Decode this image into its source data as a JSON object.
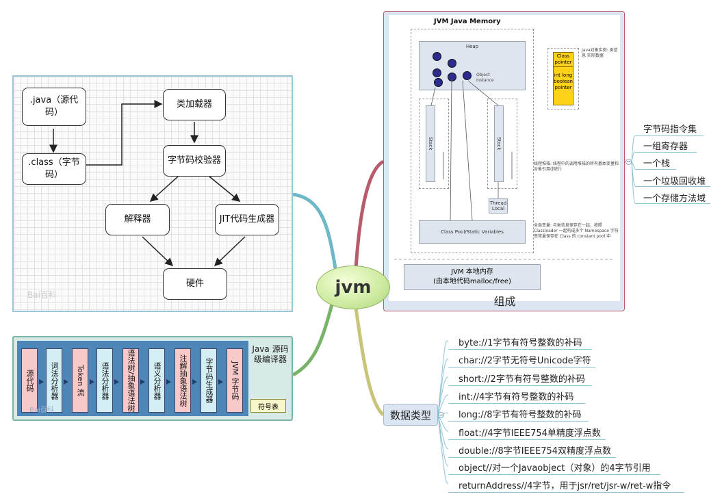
{
  "center": {
    "label": "jvm"
  },
  "class_loading": {
    "java_source": ".java（源代码）",
    "class_file": ".class（字节码）",
    "class_loader": "类加载器",
    "verifier": "字节码校验器",
    "interpreter": "解释器",
    "jit": "JIT代码生成器",
    "hardware": "硬件",
    "watermark": "Bai百科"
  },
  "compiler": {
    "title": "Java 源码级编译器",
    "symbol_table": "符号表",
    "stages": [
      "源代码",
      "词法分析器",
      "Token 流",
      "语法分析器",
      "语法树/抽象语法树",
      "语义分析器",
      "注解抽象语法树",
      "字节码生成器",
      "JVM 字节码"
    ],
    "watermark": "Bai百科"
  },
  "memory": {
    "title": "JVM Java Memory",
    "heap": "Heap",
    "object_instance": "Object Instance",
    "stack": "Stack",
    "thread_local": "Thread Local",
    "class_pool": "Class Pool/Static Variables",
    "class_pointer": "Class pointer",
    "primitives": "int long boolean pointer",
    "object_note": "Java对象实例: 类信息 实际数据",
    "stack_note": "线程堆栈: 线程中的调用堆栈的所有基本变量和对象引用(指针)",
    "pool_note": "全局变量: 与类信息保存在一起，按照 Classloader 一起构成多个 Namespace 字符串常量保存在 Class 的 constant pool 中",
    "native": "JVM 本地内存",
    "native_sub": "(由本地代码malloc/free)",
    "label": "组成"
  },
  "components": {
    "title": "字节码指令集",
    "items": [
      "一组寄存器",
      "一个栈",
      "一个垃圾回收堆",
      "一个存储方法域"
    ]
  },
  "data_types": {
    "label": "数据类型",
    "items": [
      "byte://1字节有符号整数的补码",
      "char://2字节无符号Unicode字符",
      "short://2字节有符号整数的补码",
      "int://4字节有符号整数的补码",
      "long://8字节有符号整数的补码",
      "float://4字节IEEE754单精度浮点数",
      "double://8字节IEEE754双精度浮点数",
      "object//对一个Javaobject（对象）的4字节引用",
      "returnAddress//4字节，用于jsr/ret/jsr-w/ret-w指令"
    ]
  }
}
